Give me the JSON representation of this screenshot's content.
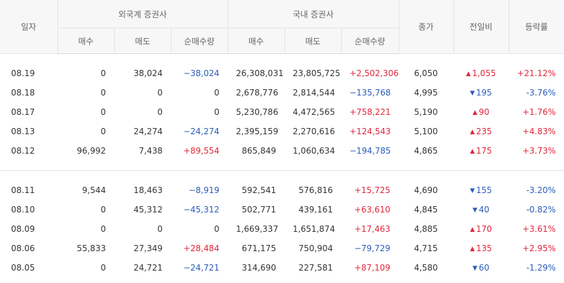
{
  "headers": {
    "date": "일자",
    "foreign_group": "외국계 증권사",
    "domestic_group": "국내 증권사",
    "close": "종가",
    "change": "전일비",
    "rate": "등락률",
    "buy": "매수",
    "sell": "매도",
    "net": "순매수량"
  },
  "colors": {
    "up": "#e0263a",
    "down": "#2a5cb8"
  },
  "rows": [
    {
      "date": "08.19",
      "f_buy": "0",
      "f_sell": "38,024",
      "f_net": "−38,024",
      "f_net_dir": "down",
      "d_buy": "26,308,031",
      "d_sell": "23,805,725",
      "d_net": "+2,502,306",
      "d_net_dir": "up",
      "close": "6,050",
      "change": "1,055",
      "change_dir": "up",
      "rate": "+21.12%",
      "rate_dir": "up"
    },
    {
      "date": "08.18",
      "f_buy": "0",
      "f_sell": "0",
      "f_net": "0",
      "f_net_dir": "none",
      "d_buy": "2,678,776",
      "d_sell": "2,814,544",
      "d_net": "−135,768",
      "d_net_dir": "down",
      "close": "4,995",
      "change": "195",
      "change_dir": "down",
      "rate": "-3.76%",
      "rate_dir": "down"
    },
    {
      "date": "08.17",
      "f_buy": "0",
      "f_sell": "0",
      "f_net": "0",
      "f_net_dir": "none",
      "d_buy": "5,230,786",
      "d_sell": "4,472,565",
      "d_net": "+758,221",
      "d_net_dir": "up",
      "close": "5,190",
      "change": "90",
      "change_dir": "up",
      "rate": "+1.76%",
      "rate_dir": "up"
    },
    {
      "date": "08.13",
      "f_buy": "0",
      "f_sell": "24,274",
      "f_net": "−24,274",
      "f_net_dir": "down",
      "d_buy": "2,395,159",
      "d_sell": "2,270,616",
      "d_net": "+124,543",
      "d_net_dir": "up",
      "close": "5,100",
      "change": "235",
      "change_dir": "up",
      "rate": "+4.83%",
      "rate_dir": "up"
    },
    {
      "date": "08.12",
      "f_buy": "96,992",
      "f_sell": "7,438",
      "f_net": "+89,554",
      "f_net_dir": "up",
      "d_buy": "865,849",
      "d_sell": "1,060,634",
      "d_net": "−194,785",
      "d_net_dir": "down",
      "close": "4,865",
      "change": "175",
      "change_dir": "up",
      "rate": "+3.73%",
      "rate_dir": "up"
    },
    {
      "date": "08.11",
      "f_buy": "9,544",
      "f_sell": "18,463",
      "f_net": "−8,919",
      "f_net_dir": "down",
      "d_buy": "592,541",
      "d_sell": "576,816",
      "d_net": "+15,725",
      "d_net_dir": "up",
      "close": "4,690",
      "change": "155",
      "change_dir": "down",
      "rate": "-3.20%",
      "rate_dir": "down"
    },
    {
      "date": "08.10",
      "f_buy": "0",
      "f_sell": "45,312",
      "f_net": "−45,312",
      "f_net_dir": "down",
      "d_buy": "502,771",
      "d_sell": "439,161",
      "d_net": "+63,610",
      "d_net_dir": "up",
      "close": "4,845",
      "change": "40",
      "change_dir": "down",
      "rate": "-0.82%",
      "rate_dir": "down"
    },
    {
      "date": "08.09",
      "f_buy": "0",
      "f_sell": "0",
      "f_net": "0",
      "f_net_dir": "none",
      "d_buy": "1,669,337",
      "d_sell": "1,651,874",
      "d_net": "+17,463",
      "d_net_dir": "up",
      "close": "4,885",
      "change": "170",
      "change_dir": "up",
      "rate": "+3.61%",
      "rate_dir": "up"
    },
    {
      "date": "08.06",
      "f_buy": "55,833",
      "f_sell": "27,349",
      "f_net": "+28,484",
      "f_net_dir": "up",
      "d_buy": "671,175",
      "d_sell": "750,904",
      "d_net": "−79,729",
      "d_net_dir": "down",
      "close": "4,715",
      "change": "135",
      "change_dir": "up",
      "rate": "+2.95%",
      "rate_dir": "up"
    },
    {
      "date": "08.05",
      "f_buy": "0",
      "f_sell": "24,721",
      "f_net": "−24,721",
      "f_net_dir": "down",
      "d_buy": "314,690",
      "d_sell": "227,581",
      "d_net": "+87,109",
      "d_net_dir": "up",
      "close": "4,580",
      "change": "60",
      "change_dir": "down",
      "rate": "-1.29%",
      "rate_dir": "down"
    }
  ]
}
